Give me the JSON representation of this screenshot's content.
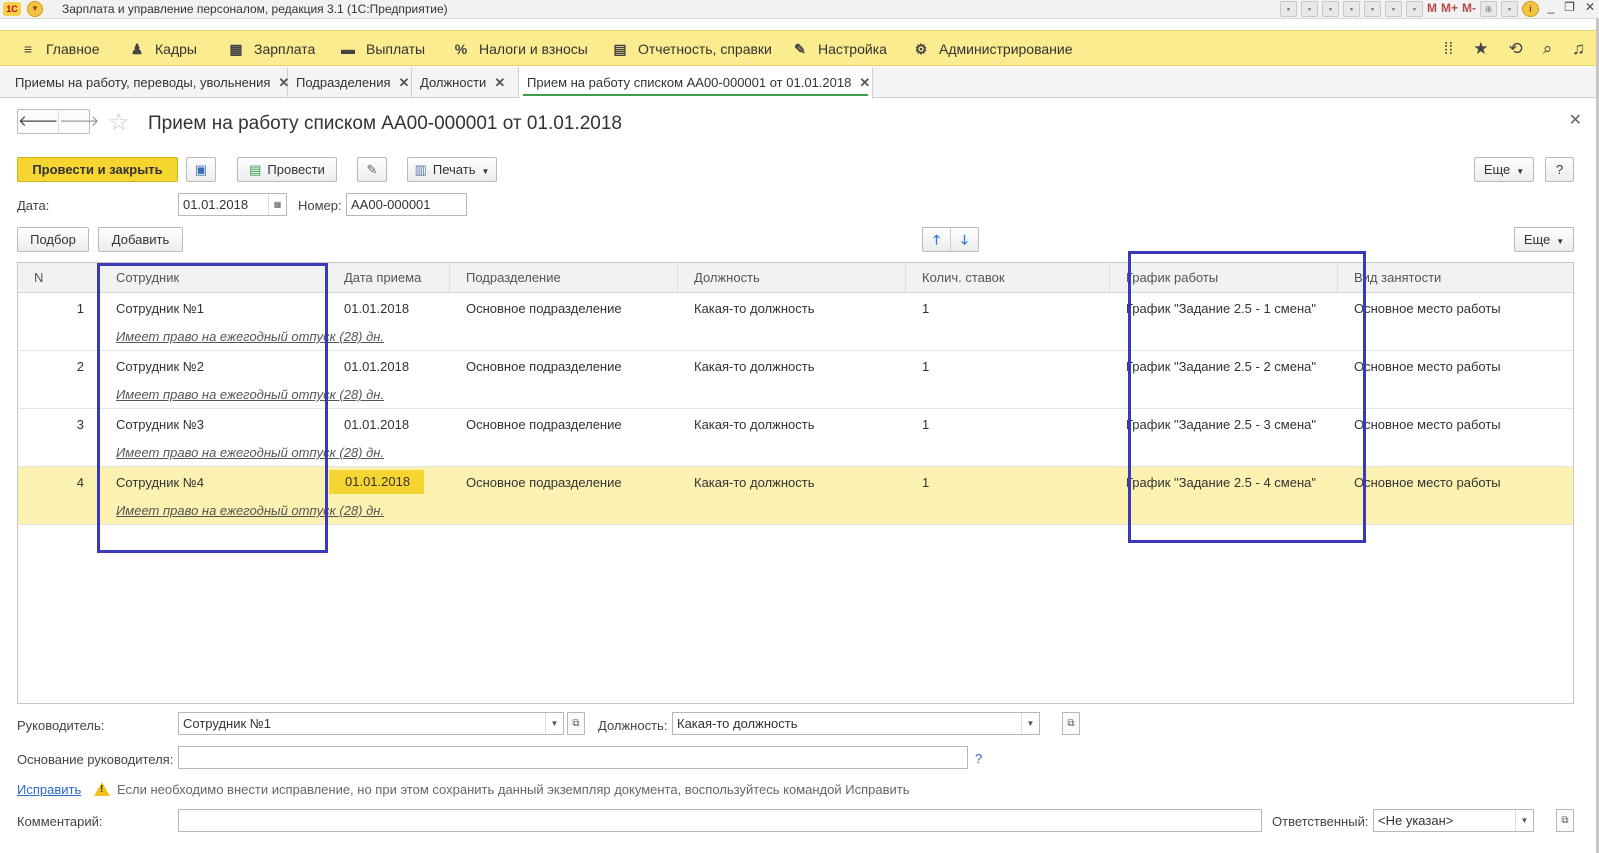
{
  "window": {
    "title": "Зарплата и управление персоналом, редакция 3.1  (1С:Предприятие)",
    "logo_text": "1С",
    "tool_m": "M",
    "tool_m_plus": "M+",
    "tool_m_minus": "M-"
  },
  "main_menu": {
    "items": [
      {
        "label": "Главное",
        "icon": "menu-lines-icon"
      },
      {
        "label": "Кадры",
        "icon": "people-icon"
      },
      {
        "label": "Зарплата",
        "icon": "calculator-icon"
      },
      {
        "label": "Выплаты",
        "icon": "wallet-icon"
      },
      {
        "label": "Налоги и взносы",
        "icon": "percent-icon"
      },
      {
        "label": "Отчетность, справки",
        "icon": "report-icon"
      },
      {
        "label": "Настройка",
        "icon": "wrench-icon"
      },
      {
        "label": "Администрирование",
        "icon": "gear-icon"
      }
    ],
    "percent_glyph": "%"
  },
  "tabs": [
    {
      "label": "Приемы на работу, переводы, увольнения"
    },
    {
      "label": "Подразделения"
    },
    {
      "label": "Должности"
    },
    {
      "label": "Прием на работу списком АА00-000001 от 01.01.2018",
      "active": true
    }
  ],
  "document": {
    "title": "Прием на работу списком АА00-000001 от 01.01.2018"
  },
  "toolbar": {
    "post_close": "Провести и закрыть",
    "post": "Провести",
    "print": "Печать",
    "more": "Еще",
    "help": "?"
  },
  "header_fields": {
    "date_label": "Дата:",
    "date_value": "01.01.2018",
    "number_label": "Номер:",
    "number_value": "АА00-000001"
  },
  "table_toolbar": {
    "select": "Подбор",
    "add": "Добавить",
    "more": "Еще"
  },
  "table": {
    "columns": [
      "N",
      "Сотрудник",
      "Дата приема",
      "Подразделение",
      "Должность",
      "Колич. ставок",
      "График работы",
      "Вид занятости"
    ],
    "rows": [
      {
        "n": "1",
        "employee": "Сотрудник №1",
        "date": "01.01.2018",
        "department": "Основное подразделение",
        "position": "Какая-то должность",
        "rate": "1",
        "schedule": "График \"Задание 2.5 - 1 смена\"",
        "employment": "Основное место работы",
        "vacation": "Имеет право на ежегодный отпуск (28) дн."
      },
      {
        "n": "2",
        "employee": "Сотрудник №2",
        "date": "01.01.2018",
        "department": "Основное подразделение",
        "position": "Какая-то должность",
        "rate": "1",
        "schedule": "График \"Задание 2.5 - 2 смена\"",
        "employment": "Основное место работы",
        "vacation": "Имеет право на ежегодный отпуск (28) дн."
      },
      {
        "n": "3",
        "employee": "Сотрудник №3",
        "date": "01.01.2018",
        "department": "Основное подразделение",
        "position": "Какая-то должность",
        "rate": "1",
        "schedule": "График \"Задание 2.5 - 3 смена\"",
        "employment": "Основное место работы",
        "vacation": "Имеет право на ежегодный отпуск (28) дн."
      },
      {
        "n": "4",
        "employee": "Сотрудник №4",
        "date": "01.01.2018",
        "department": "Основное подразделение",
        "position": "Какая-то должность",
        "rate": "1",
        "schedule": "График \"Задание 2.5 - 4 смена\"",
        "employment": "Основное место работы",
        "vacation": "Имеет право на ежегодный отпуск (28) дн.",
        "selected": true
      }
    ]
  },
  "footer": {
    "manager_label": "Руководитель:",
    "manager_value": "Сотрудник №1",
    "position_label": "Должность:",
    "position_value": "Какая-то должность",
    "basis_label": "Основание руководителя:",
    "basis_value": "",
    "help": "?",
    "fix_link": "Исправить",
    "fix_note": "Если необходимо внести исправление, но при этом сохранить данный экземпляр документа, воспользуйтесь командой Исправить",
    "comment_label": "Комментарий:",
    "comment_value": "",
    "responsible_label": "Ответственный:",
    "responsible_value": "<Не указан>"
  },
  "colors": {
    "menu_bg": "#fbec8f",
    "primary_button": "#f7d531",
    "selected_row": "#fbf1b0",
    "annotation_box": "#3a3ab8",
    "link": "#2b6cc4"
  }
}
